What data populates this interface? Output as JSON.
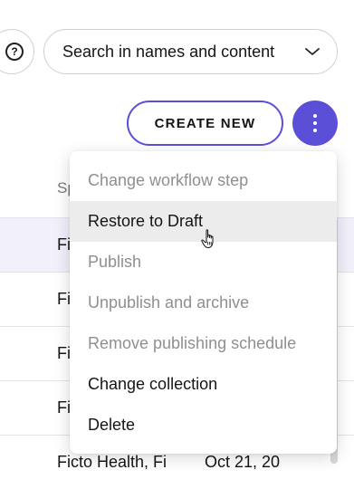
{
  "toolbar": {
    "help_icon_glyph": "?",
    "search_scope_label": "Search in names and content",
    "create_new_label": "CREATE NEW",
    "accent_color": "#5b4fd8"
  },
  "table": {
    "header_partial": "Sp",
    "rows": [
      {
        "col1": "Fi",
        "col2": ""
      },
      {
        "col1": "Fi",
        "col2": ""
      },
      {
        "col1": "Fi",
        "col2": ""
      },
      {
        "col1": "Fi",
        "col2": ""
      },
      {
        "col1": "Ficto Health, Fi",
        "col2": "Oct 21, 20"
      }
    ]
  },
  "menu": {
    "items": [
      {
        "label": "Change workflow step",
        "enabled": false
      },
      {
        "label": "Restore to Draft",
        "enabled": true,
        "hovered": true
      },
      {
        "label": "Publish",
        "enabled": false
      },
      {
        "label": "Unpublish and archive",
        "enabled": false
      },
      {
        "label": "Remove publishing schedule",
        "enabled": false
      },
      {
        "label": "Change collection",
        "enabled": true
      },
      {
        "label": "Delete",
        "enabled": true
      }
    ]
  }
}
